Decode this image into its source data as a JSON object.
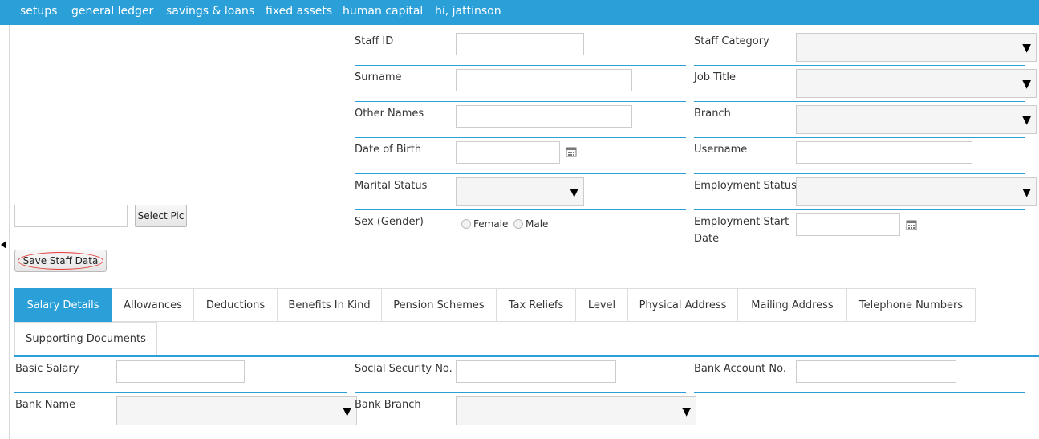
{
  "nav": {
    "items": [
      "setups",
      "general ledger",
      "savings & loans",
      "fixed assets",
      "human capital",
      "hi, jattinson"
    ]
  },
  "photo": {
    "select_pic_label": "Select Pic"
  },
  "save_label": "Save Staff Data",
  "form": {
    "staff_id": "Staff ID",
    "surname": "Surname",
    "other_names": "Other Names",
    "date_of_birth": "Date of Birth",
    "marital_status": "Marital Status",
    "sex": "Sex (Gender)",
    "female": "Female",
    "male": "Male",
    "staff_category": "Staff Category",
    "job_title": "Job Title",
    "branch": "Branch",
    "username": "Username",
    "employment_status": "Employment Status",
    "employment_start_date": "Employment Start Date"
  },
  "tabs": [
    "Salary Details",
    "Allowances",
    "Deductions",
    "Benefits In Kind",
    "Pension Schemes",
    "Tax Reliefs",
    "Level",
    "Physical Address",
    "Mailing Address",
    "Telephone Numbers",
    "Supporting Documents"
  ],
  "salary": {
    "basic_salary": "Basic Salary",
    "social_security_no": "Social Security No.",
    "bank_account_no": "Bank Account No.",
    "bank_name": "Bank Name",
    "bank_branch": "Bank Branch"
  },
  "colors": {
    "accent": "#2a9fd8",
    "save_outline": "#e53935"
  },
  "icons": {
    "dropdown": "▼",
    "calendar": "calendar-icon",
    "collapse": "chevron-left-icon"
  }
}
